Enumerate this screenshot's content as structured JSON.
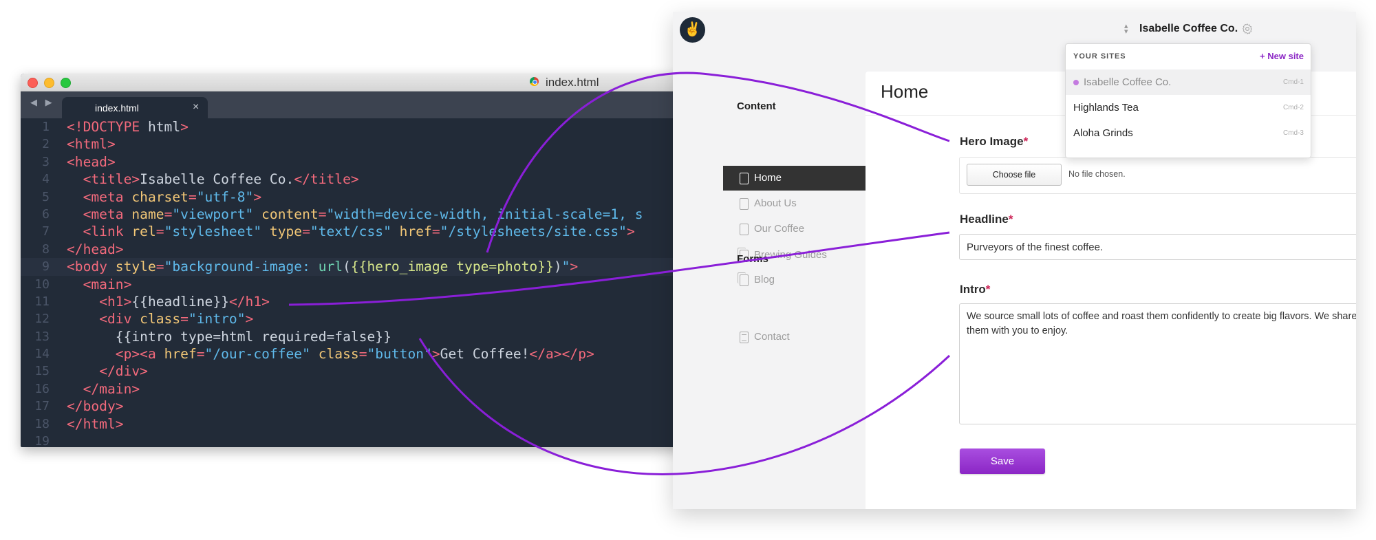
{
  "editor": {
    "window_title": "index.html",
    "tab_label": "index.html",
    "tab_close": "×",
    "nav_arrows": "◀ ▶",
    "active_line": 9,
    "lines": [
      [
        {
          "t": "<!DOCTYPE ",
          "c": "tag"
        },
        {
          "t": "html",
          "c": "text"
        },
        {
          "t": ">",
          "c": "tag"
        }
      ],
      [
        {
          "t": "<html>",
          "c": "tag"
        }
      ],
      [
        {
          "t": "<head>",
          "c": "tag"
        }
      ],
      [
        {
          "t": "  "
        },
        {
          "t": "<title>",
          "c": "tag"
        },
        {
          "t": "Isabelle Coffee Co.",
          "c": "text"
        },
        {
          "t": "</title>",
          "c": "tag"
        }
      ],
      [
        {
          "t": "  "
        },
        {
          "t": "<meta ",
          "c": "tag"
        },
        {
          "t": "charset",
          "c": "attr"
        },
        {
          "t": "=",
          "c": "tag"
        },
        {
          "t": "\"utf-8\"",
          "c": "str"
        },
        {
          "t": ">",
          "c": "tag"
        }
      ],
      [
        {
          "t": "  "
        },
        {
          "t": "<meta ",
          "c": "tag"
        },
        {
          "t": "name",
          "c": "attr"
        },
        {
          "t": "=",
          "c": "tag"
        },
        {
          "t": "\"viewport\" ",
          "c": "str"
        },
        {
          "t": "content",
          "c": "attr"
        },
        {
          "t": "=",
          "c": "tag"
        },
        {
          "t": "\"width=device-width, initial-scale=1, s",
          "c": "str"
        }
      ],
      [
        {
          "t": "  "
        },
        {
          "t": "<link ",
          "c": "tag"
        },
        {
          "t": "rel",
          "c": "attr"
        },
        {
          "t": "=",
          "c": "tag"
        },
        {
          "t": "\"stylesheet\" ",
          "c": "str"
        },
        {
          "t": "type",
          "c": "attr"
        },
        {
          "t": "=",
          "c": "tag"
        },
        {
          "t": "\"text/css\" ",
          "c": "str"
        },
        {
          "t": "href",
          "c": "attr"
        },
        {
          "t": "=",
          "c": "tag"
        },
        {
          "t": "\"/stylesheets/site.css\"",
          "c": "str"
        },
        {
          "t": ">",
          "c": "tag"
        }
      ],
      [
        {
          "t": "</head>",
          "c": "tag"
        }
      ],
      [
        {
          "t": "<body ",
          "c": "tag"
        },
        {
          "t": "style",
          "c": "attr"
        },
        {
          "t": "=",
          "c": "tag"
        },
        {
          "t": "\"background-image: ",
          "c": "str"
        },
        {
          "t": "url",
          "c": "fn"
        },
        {
          "t": "(",
          "c": "text"
        },
        {
          "t": "{{hero_image type=photo}}",
          "c": "tplk"
        },
        {
          "t": ")",
          "c": "text"
        },
        {
          "t": "\"",
          "c": "str"
        },
        {
          "t": ">",
          "c": "tag"
        }
      ],
      [
        {
          "t": "  "
        },
        {
          "t": "<main>",
          "c": "tag"
        }
      ],
      [
        {
          "t": "    "
        },
        {
          "t": "<h1>",
          "c": "tag"
        },
        {
          "t": "{{headline}}",
          "c": "tpl"
        },
        {
          "t": "</h1>",
          "c": "tag"
        }
      ],
      [
        {
          "t": "    "
        },
        {
          "t": "<div ",
          "c": "tag"
        },
        {
          "t": "class",
          "c": "attr"
        },
        {
          "t": "=",
          "c": "tag"
        },
        {
          "t": "\"intro\"",
          "c": "str"
        },
        {
          "t": ">",
          "c": "tag"
        }
      ],
      [
        {
          "t": "      "
        },
        {
          "t": "{{intro type=html required=false}}",
          "c": "tpl"
        }
      ],
      [
        {
          "t": "      "
        },
        {
          "t": "<p><a ",
          "c": "tag"
        },
        {
          "t": "href",
          "c": "attr"
        },
        {
          "t": "=",
          "c": "tag"
        },
        {
          "t": "\"/our-coffee\" ",
          "c": "str"
        },
        {
          "t": "class",
          "c": "attr"
        },
        {
          "t": "=",
          "c": "tag"
        },
        {
          "t": "\"button\"",
          "c": "str"
        },
        {
          "t": ">",
          "c": "tag"
        },
        {
          "t": "Get Coffee!",
          "c": "text"
        },
        {
          "t": "</a></p>",
          "c": "tag"
        }
      ],
      [
        {
          "t": "    "
        },
        {
          "t": "</div>",
          "c": "tag"
        }
      ],
      [
        {
          "t": "  "
        },
        {
          "t": "</main>",
          "c": "tag"
        }
      ],
      [
        {
          "t": "</body>",
          "c": "tag"
        }
      ],
      [
        {
          "t": "</html>",
          "c": "tag"
        }
      ],
      []
    ]
  },
  "cms": {
    "logo_glyph": "✌",
    "site_name": "Isabelle Coffee Co.",
    "site_switch_arrows": "⌃⌄",
    "sidebar": {
      "content_heading": "Content",
      "forms_heading": "Forms",
      "items": [
        {
          "label": "Home",
          "icon": "page-icon",
          "active": true
        },
        {
          "label": "About Us",
          "icon": "page-icon",
          "active": false
        },
        {
          "label": "Our Coffee",
          "icon": "page-icon",
          "active": false
        },
        {
          "label": "Brewing Guides",
          "icon": "stack-icon",
          "active": false
        },
        {
          "label": "Blog",
          "icon": "stack-icon",
          "active": false
        }
      ],
      "forms": [
        {
          "label": "Contact",
          "icon": "form-icon"
        }
      ]
    },
    "page_title": "Home",
    "required_mark": "*",
    "hero": {
      "label": "Hero Image",
      "button": "Choose file",
      "status": "No file chosen."
    },
    "headline": {
      "label": "Headline",
      "value": "Purveyors of the finest coffee."
    },
    "intro": {
      "label": "Intro",
      "value": "We source small lots of coffee and roast them confidently to create big flavors. We share them with you to enjoy."
    },
    "save_label": "Save",
    "sites_dropdown": {
      "heading": "YOUR SITES",
      "new_site": "+ New site",
      "sites": [
        {
          "name": "Isabelle Coffee Co.",
          "shortcut": "Cmd-1",
          "current": true
        },
        {
          "name": "Highlands Tea",
          "shortcut": "Cmd-2",
          "current": false
        },
        {
          "name": "Aloha Grinds",
          "shortcut": "Cmd-3",
          "current": false
        }
      ]
    }
  },
  "colors": {
    "accent_purple": "#8b26c5",
    "editor_bg": "#222b38",
    "connector": "#8a1fd8"
  }
}
